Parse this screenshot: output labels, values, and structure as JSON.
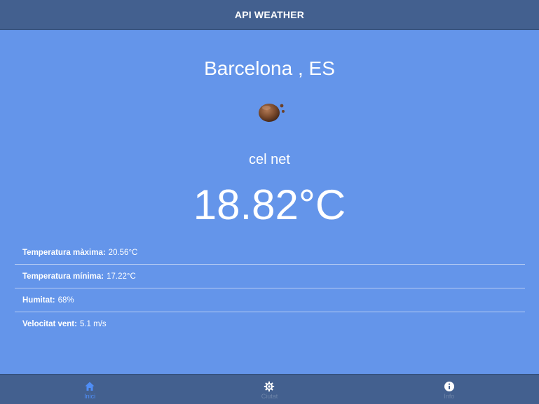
{
  "header": {
    "title": "API WEATHER"
  },
  "weather": {
    "city": "Barcelona , ES",
    "icon": "scattered-clouds-icon",
    "description": "cel net",
    "temperature": "18.82°C"
  },
  "details": [
    {
      "label": "Temperatura màxima:",
      "value": "20.56°C"
    },
    {
      "label": "Temperatura mínima:",
      "value": "17.22°C"
    },
    {
      "label": "Humitat:",
      "value": "68%"
    },
    {
      "label": "Velocitat vent:",
      "value": "5.1 m/s"
    }
  ],
  "tabs": [
    {
      "label": "Inici",
      "icon": "home-icon",
      "active": true
    },
    {
      "label": "Ciutat",
      "icon": "settings-icon",
      "active": false
    },
    {
      "label": "Info",
      "icon": "info-icon",
      "active": false
    }
  ],
  "colors": {
    "background": "#6495ea",
    "bar": "#43608f",
    "active_tab": "#4f8ef7",
    "inactive_tab": "#ffffff"
  }
}
